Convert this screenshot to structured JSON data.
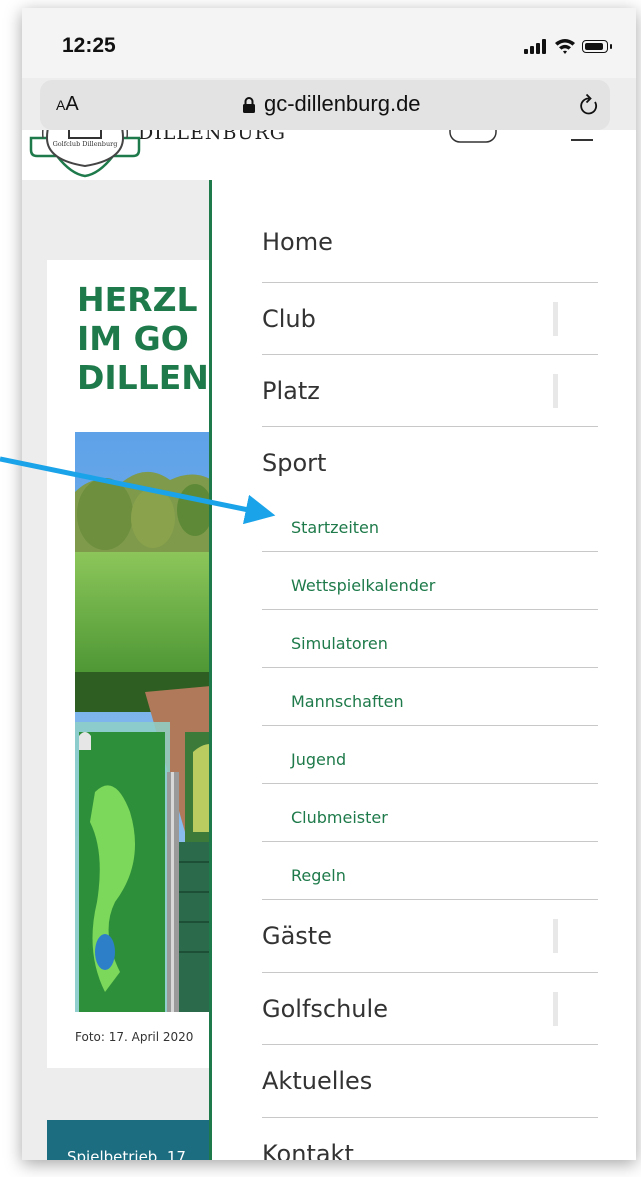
{
  "status_bar": {
    "time": "12:25"
  },
  "url_bar": {
    "aa_small": "A",
    "aa_large": "A",
    "url": "gc-dillenburg.de"
  },
  "site": {
    "brand": "DILLENBURG",
    "logo_text": "Golfclub Dillenburg",
    "hero_title_lines": [
      "HERZL",
      "IM GO",
      "DILLEN"
    ],
    "caption": "Foto: 17. April 2020",
    "teal_bar_text": "Spielbetrieb, 17"
  },
  "menu": {
    "items": [
      {
        "label": "Home",
        "expandable": false
      },
      {
        "label": "Club",
        "expandable": true
      },
      {
        "label": "Platz",
        "expandable": true
      },
      {
        "label": "Sport",
        "expandable": false
      },
      {
        "label": "Gäste",
        "expandable": true
      },
      {
        "label": "Golfschule",
        "expandable": true
      },
      {
        "label": "Aktuelles",
        "expandable": false
      },
      {
        "label": "Kontakt",
        "expandable": false
      }
    ],
    "sport_submenu": [
      "Startzeiten",
      "Wettspielkalender",
      "Simulatoren",
      "Mannschaften",
      "Jugend",
      "Clubmeister",
      "Regeln"
    ]
  },
  "colors": {
    "brand_green": "#1e7a4a",
    "teal": "#1c6d80",
    "annotation_arrow": "#1aa3e8"
  },
  "annotation": {
    "points_to": "Startzeiten"
  }
}
